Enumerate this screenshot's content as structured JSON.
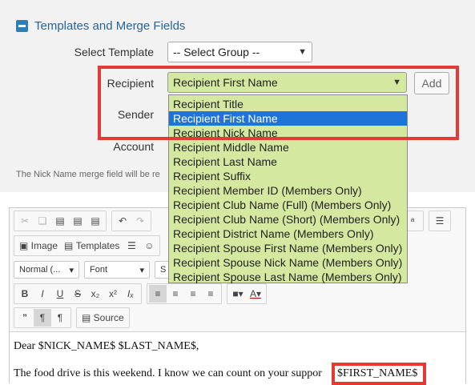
{
  "panel": {
    "title": "Templates and Merge Fields",
    "labels": {
      "select_template": "Select Template",
      "recipient": "Recipient",
      "sender": "Sender",
      "account": "Account"
    },
    "template_select_value": "-- Select Group --",
    "recipient_select_value": "Recipient First Name",
    "add_button": "Add",
    "note": "The Nick Name merge field will be re"
  },
  "dropdown": {
    "options": [
      "Recipient Title",
      "Recipient First Name",
      "Recipient Nick Name",
      "Recipient Middle Name",
      "Recipient Last Name",
      "Recipient Suffix",
      "Recipient Member ID (Members Only)",
      "Recipient Club Name (Full) (Members Only)",
      "Recipient Club Name (Short) (Members Only)",
      "Recipient District Name (Members Only)",
      "Recipient Spouse First Name (Members Only)",
      "Recipient Spouse Nick Name (Members Only)",
      "Recipient Spouse Last Name (Members Only)"
    ],
    "selected_index": 1
  },
  "editor": {
    "toolbar": {
      "image": "Image",
      "templates": "Templates",
      "format": "Normal (...",
      "font": "Font",
      "size": "S",
      "source": "Source",
      "bold": "B",
      "italic": "I",
      "underline": "U",
      "strike": "S",
      "subscript": "x₂",
      "superscript": "x²",
      "clear": "Iₓ",
      "blockquote": "”",
      "ltr": "¶",
      "rtl": "¶"
    },
    "content": {
      "line1": "Dear $NICK_NAME$ $LAST_NAME$,",
      "line2": "The food drive is this weekend. I know we can count on your suppor",
      "merge_field": "$FIRST_NAME$"
    }
  },
  "colors": {
    "accent": "#2c7fb8",
    "highlight": "#e53935",
    "select_bg": "#d4e8a0",
    "option_selected": "#1e74d8"
  }
}
